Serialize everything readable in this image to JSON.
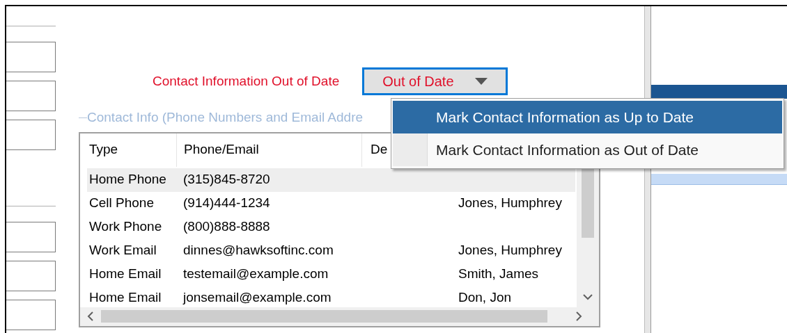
{
  "status": {
    "label": "Contact Information Out of Date",
    "dropdown_value": "Out of Date",
    "expanded": true
  },
  "menu": [
    {
      "label": "Mark Contact Information as Up to Date",
      "selected": true
    },
    {
      "label": "Mark Contact Information as Out of Date",
      "selected": false
    }
  ],
  "contact_group": {
    "title": "Contact Info (Phone Numbers and Email Addre",
    "columns": [
      "Type",
      "Phone/Email",
      "De"
    ],
    "rows": [
      {
        "type": "Home Phone",
        "value": "(315)845-8720",
        "selected": true
      },
      {
        "type": "Cell Phone",
        "value": "(914)444-1234",
        "name": "Jones, Humphrey",
        "selected": false
      },
      {
        "type": "Work Phone",
        "value": "(800)888-8888",
        "selected": false
      },
      {
        "type": "Work Email",
        "value": "dinnes@hawksoftinc.com",
        "name": "Jones, Humphrey",
        "selected": false
      },
      {
        "type": "Home Email",
        "value": "testemail@example.com",
        "name": "Smith, James",
        "selected": false
      },
      {
        "type": "Home Email",
        "value": "jonsemail@example.com",
        "name": "Don, Jon",
        "selected": false
      }
    ]
  }
}
